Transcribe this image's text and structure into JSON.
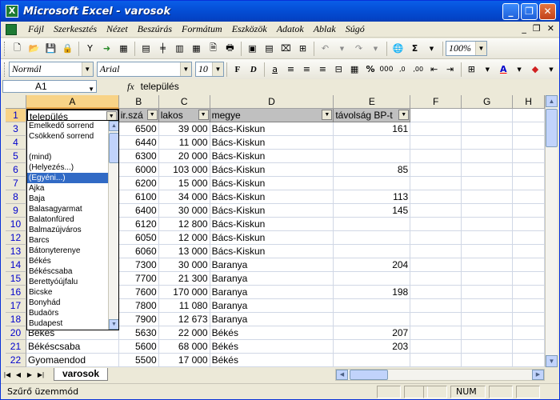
{
  "window": {
    "title": "Microsoft Excel - varosok"
  },
  "menu": {
    "items": [
      "Fájl",
      "Szerkesztés",
      "Nézet",
      "Beszúrás",
      "Formátum",
      "Eszközök",
      "Adatok",
      "Ablak",
      "Súgó"
    ]
  },
  "formatting": {
    "font_style": "Normál",
    "font_name": "Arial",
    "font_size": "10",
    "zoom": "100%"
  },
  "formula_bar": {
    "cell_ref": "A1",
    "fx": "fx",
    "value": "település"
  },
  "columns": [
    "A",
    "B",
    "C",
    "D",
    "E",
    "F",
    "G",
    "H"
  ],
  "header_row": {
    "row_number": "1",
    "cells": [
      "település",
      "ir.szá",
      "lakos",
      "megye",
      "távolság BP-t",
      "",
      "",
      ""
    ]
  },
  "rows": [
    {
      "num": "3",
      "a": "",
      "b": "6500",
      "c": "39 000",
      "d": "Bács-Kiskun",
      "e": "161"
    },
    {
      "num": "4",
      "a": "",
      "b": "6440",
      "c": "11 000",
      "d": "Bács-Kiskun",
      "e": ""
    },
    {
      "num": "5",
      "a": "",
      "b": "6300",
      "c": "20 000",
      "d": "Bács-Kiskun",
      "e": ""
    },
    {
      "num": "6",
      "a": "",
      "b": "6000",
      "c": "103 000",
      "d": "Bács-Kiskun",
      "e": "85"
    },
    {
      "num": "7",
      "a": "",
      "b": "6200",
      "c": "15 000",
      "d": "Bács-Kiskun",
      "e": ""
    },
    {
      "num": "8",
      "a": "",
      "b": "6100",
      "c": "34 000",
      "d": "Bács-Kiskun",
      "e": "113"
    },
    {
      "num": "9",
      "a": "",
      "b": "6400",
      "c": "30 000",
      "d": "Bács-Kiskun",
      "e": "145"
    },
    {
      "num": "10",
      "a": "",
      "b": "6120",
      "c": "12 800",
      "d": "Bács-Kiskun",
      "e": ""
    },
    {
      "num": "12",
      "a": "",
      "b": "6050",
      "c": "12 000",
      "d": "Bács-Kiskun",
      "e": ""
    },
    {
      "num": "13",
      "a": "",
      "b": "6060",
      "c": "13 000",
      "d": "Bács-Kiskun",
      "e": ""
    },
    {
      "num": "14",
      "a": "",
      "b": "7300",
      "c": "30 000",
      "d": "Baranya",
      "e": "204"
    },
    {
      "num": "15",
      "a": "",
      "b": "7700",
      "c": "21 300",
      "d": "Baranya",
      "e": ""
    },
    {
      "num": "16",
      "a": "",
      "b": "7600",
      "c": "170 000",
      "d": "Baranya",
      "e": "198"
    },
    {
      "num": "17",
      "a": "",
      "b": "7800",
      "c": "11 080",
      "d": "Baranya",
      "e": ""
    },
    {
      "num": "18",
      "a": "",
      "b": "7900",
      "c": "12 673",
      "d": "Baranya",
      "e": ""
    },
    {
      "num": "20",
      "a": "Békés",
      "b": "5630",
      "c": "22 000",
      "d": "Békés",
      "e": "207"
    },
    {
      "num": "21",
      "a": "Békéscsaba",
      "b": "5600",
      "c": "68 000",
      "d": "Békés",
      "e": "203"
    },
    {
      "num": "22",
      "a": "Gyomaendod",
      "b": "5500",
      "c": "17 000",
      "d": "Békés",
      "e": ""
    }
  ],
  "filter_dropdown": {
    "sort_items": [
      "Emelkedő sorrend",
      "Csökkenő sorrend"
    ],
    "items": [
      "(mind)",
      "(Helyezés...)",
      "(Egyéni...)",
      "Ajka",
      "Baja",
      "Balasagyarmat",
      "Balatonfüred",
      "Balmazújváros",
      "Barcs",
      "Bátonyterenye",
      "Békés",
      "Békéscsaba",
      "Berettyóújfalu",
      "Bicske",
      "Bonyhád",
      "Budaörs",
      "Budapest"
    ],
    "selected": "(Egyéni...)"
  },
  "sheet_tabs": {
    "active": "varosok"
  },
  "status": {
    "left": "Szűrő üzemmód",
    "num": "NUM"
  }
}
